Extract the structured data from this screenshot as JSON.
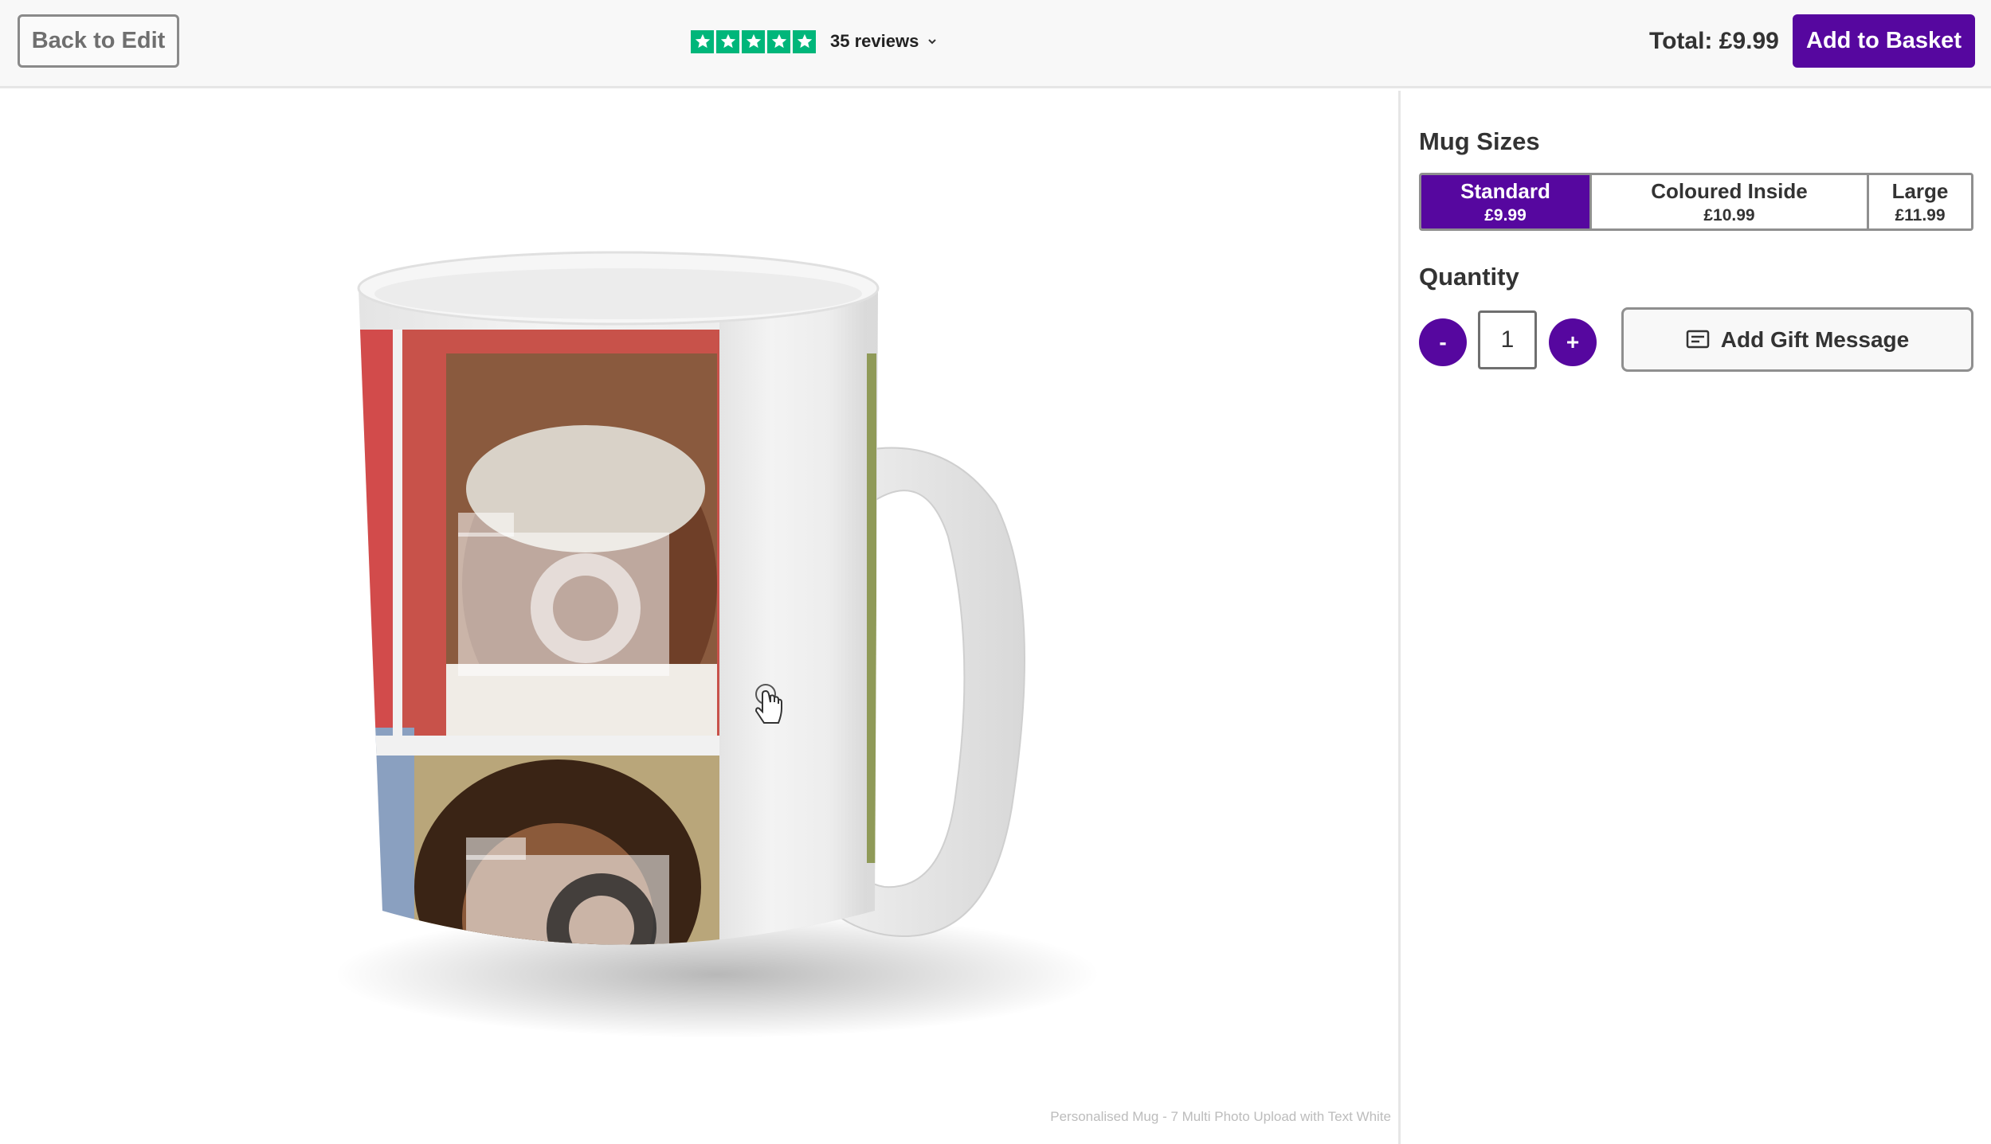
{
  "header": {
    "back_label": "Back to Edit",
    "reviews_label": "35 reviews",
    "rating_stars": 5,
    "total_label": "Total: £9.99",
    "basket_label": "Add to Basket"
  },
  "options": {
    "sizes_title": "Mug Sizes",
    "sizes": [
      {
        "name": "Standard",
        "price": "£9.99",
        "selected": true
      },
      {
        "name": "Coloured Inside",
        "price": "£10.99",
        "selected": false
      },
      {
        "name": "Large",
        "price": "£11.99",
        "selected": false
      }
    ],
    "quantity_title": "Quantity",
    "quantity_value": "1",
    "minus_label": "-",
    "plus_label": "+",
    "gift_label": "Add Gift Message"
  },
  "footer": {
    "product_name": "Personalised Mug - 7 Multi Photo Upload with Text White"
  },
  "colors": {
    "accent": "#56079f",
    "trustpilot_green": "#00b67a"
  },
  "icons": {
    "star": "star-icon",
    "chevron": "chevron-down-icon",
    "gift": "message-icon",
    "cursor": "hand-pointer-icon"
  }
}
